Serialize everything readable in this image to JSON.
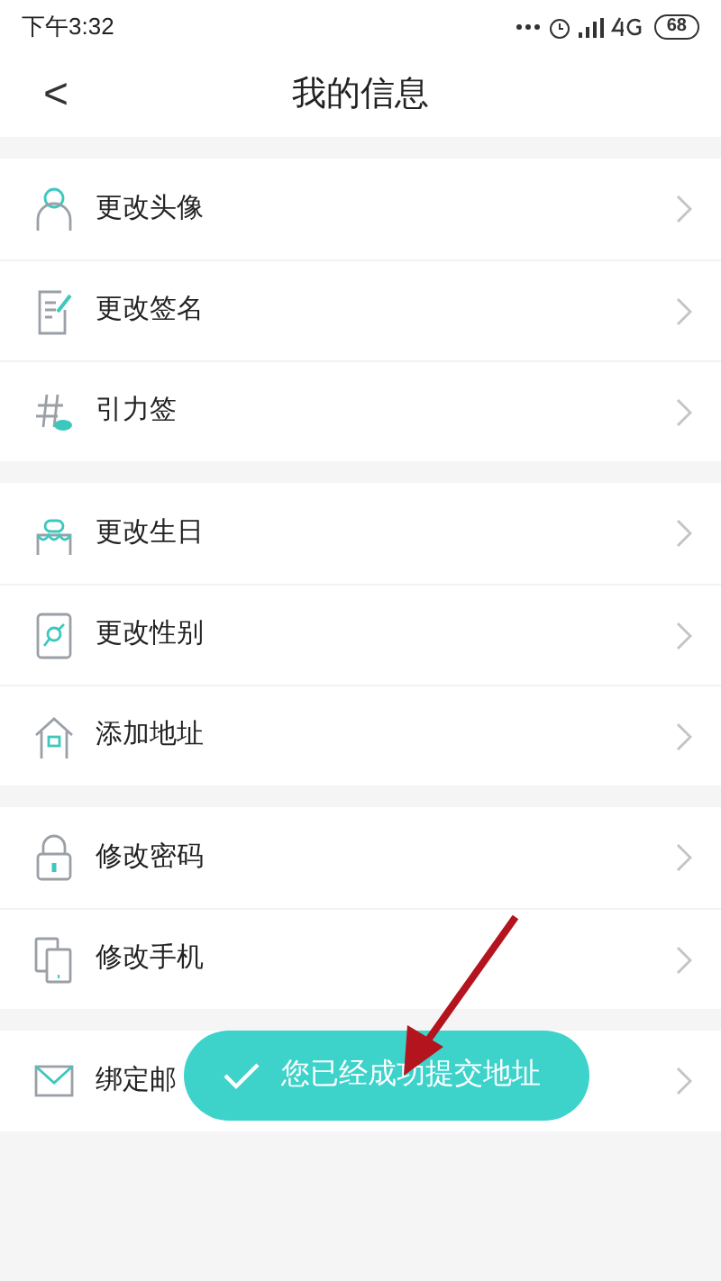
{
  "status_bar": {
    "time": "下午3:32",
    "battery": "68"
  },
  "header": {
    "back": "<",
    "title": "我的信息"
  },
  "groups": [
    {
      "items": [
        {
          "kind": "person",
          "label": "更改头像"
        },
        {
          "kind": "signature",
          "label": "更改签名"
        },
        {
          "kind": "hashtag",
          "label": "引力签"
        }
      ]
    },
    {
      "items": [
        {
          "kind": "cake",
          "label": "更改生日"
        },
        {
          "kind": "gender",
          "label": "更改性别"
        },
        {
          "kind": "house",
          "label": "添加地址"
        }
      ]
    },
    {
      "items": [
        {
          "kind": "lock",
          "label": "修改密码"
        },
        {
          "kind": "phone",
          "label": "修改手机"
        }
      ]
    },
    {
      "items": [
        {
          "kind": "mail",
          "label": "绑定邮"
        }
      ]
    }
  ],
  "toast": {
    "message": "您已经成功提交地址"
  }
}
